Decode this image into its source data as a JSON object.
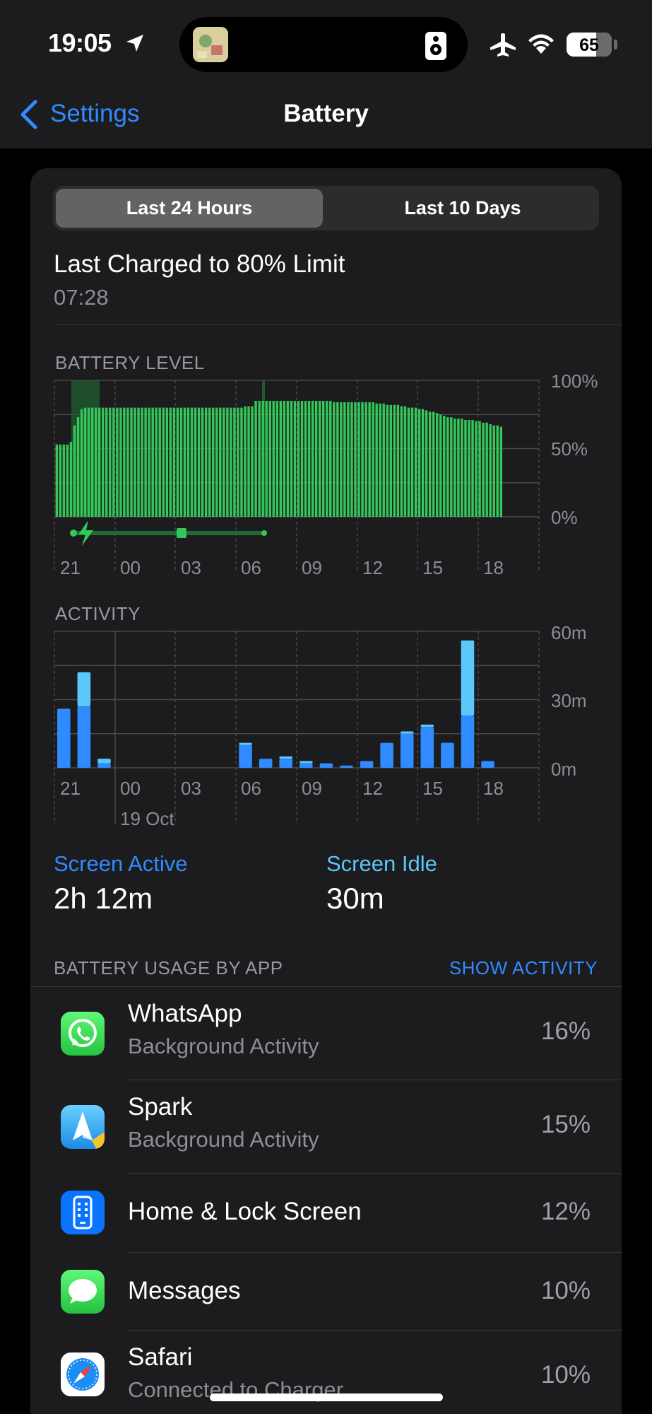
{
  "status_bar": {
    "time": "19:05",
    "battery_percent": "65",
    "battery_level": 0.65,
    "icons": [
      "location-arrow-icon",
      "now-playing-artwork",
      "speaker-icon",
      "airplane-icon",
      "wifi-icon",
      "battery-icon"
    ]
  },
  "nav": {
    "back_label": "Settings",
    "title": "Battery"
  },
  "segmented": {
    "options": [
      "Last 24 Hours",
      "Last 10 Days"
    ],
    "selected": "Last 24 Hours"
  },
  "last_charged": {
    "title": "Last Charged to 80% Limit",
    "time": "07:28"
  },
  "battery_chart": {
    "label": "BATTERY LEVEL",
    "y_ticks": [
      "100%",
      "50%",
      "0%"
    ],
    "x_ticks": [
      "21",
      "00",
      "03",
      "06",
      "09",
      "12",
      "15",
      "18"
    ]
  },
  "activity_chart": {
    "label": "ACTIVITY",
    "y_ticks": [
      "60m",
      "30m",
      "0m"
    ],
    "x_ticks": [
      "21",
      "00",
      "03",
      "06",
      "09",
      "12",
      "15",
      "18"
    ],
    "date_label": "19 Oct"
  },
  "chart_data": [
    {
      "type": "bar",
      "title": "BATTERY LEVEL",
      "ylim": [
        0,
        100
      ],
      "unit": "%",
      "x_tick_labels": [
        "21",
        "00",
        "03",
        "06",
        "09",
        "12",
        "15",
        "18"
      ],
      "grid": true,
      "values": [
        53,
        53,
        53,
        53,
        55,
        67,
        73,
        79,
        80,
        80,
        80,
        80,
        80,
        80,
        80,
        80,
        80,
        80,
        80,
        80,
        80,
        80,
        80,
        80,
        80,
        80,
        80,
        80,
        80,
        80,
        80,
        80,
        80,
        80,
        80,
        80,
        80,
        80,
        80,
        80,
        80,
        80,
        80,
        80,
        80,
        80,
        80,
        80,
        80,
        80,
        80,
        80,
        80,
        81,
        81,
        81,
        85,
        85,
        85,
        85,
        85,
        85,
        85,
        85,
        85,
        85,
        85,
        85,
        85,
        85,
        85,
        85,
        85,
        85,
        85,
        85,
        85,
        85,
        84,
        84,
        84,
        84,
        84,
        84,
        84,
        84,
        84,
        84,
        84,
        84,
        83,
        83,
        83,
        82,
        82,
        82,
        82,
        81,
        81,
        80,
        80,
        80,
        79,
        79,
        78,
        77,
        77,
        76,
        75,
        74,
        73,
        73,
        72,
        72,
        72,
        71,
        71,
        71,
        70,
        70,
        69,
        69,
        68,
        67,
        67,
        66
      ]
    },
    {
      "type": "bar",
      "title": "ACTIVITY",
      "ylim": [
        0,
        60
      ],
      "unit": "m",
      "x_tick_labels": [
        "21",
        "00",
        "03",
        "06",
        "09",
        "12",
        "15",
        "18"
      ],
      "grid": true,
      "series": [
        {
          "name": "Screen Active",
          "values": [
            26,
            27,
            2,
            0,
            0,
            0,
            0,
            0,
            0,
            0,
            0,
            0,
            0,
            0,
            0,
            0,
            0,
            0,
            0,
            0,
            0,
            0,
            0,
            0,
            0,
            0,
            0,
            0,
            0,
            0,
            0,
            0,
            0,
            0,
            0,
            0,
            0,
            0,
            0,
            0,
            0,
            0,
            0,
            0,
            0,
            0,
            0,
            0,
            0,
            0,
            0,
            0,
            0,
            0,
            0,
            0,
            0,
            0,
            0,
            0,
            0,
            0,
            0,
            0,
            0,
            0,
            0,
            0,
            0,
            0,
            0,
            0,
            0,
            0,
            0,
            0,
            0,
            0,
            0,
            0,
            0,
            0,
            0,
            0,
            0,
            0,
            0,
            0,
            0,
            0,
            0,
            0,
            0,
            0,
            0,
            0,
            0,
            0,
            0,
            0,
            0,
            0,
            0,
            0,
            0,
            0,
            0,
            0,
            0,
            0,
            0,
            0,
            0,
            0,
            0,
            0,
            0,
            0,
            0,
            0,
            0,
            0,
            0,
            0,
            0,
            0
          ]
        },
        {
          "name": "Screen Idle",
          "values": [
            0,
            15,
            2
          ]
        }
      ],
      "hourly": [
        {
          "hour": "21",
          "active": 26,
          "idle": 0
        },
        {
          "hour": "22",
          "active": 27,
          "idle": 15
        },
        {
          "hour": "23",
          "active": 2,
          "idle": 2
        },
        {
          "hour": "00",
          "active": 0,
          "idle": 0
        },
        {
          "hour": "01",
          "active": 0,
          "idle": 0
        },
        {
          "hour": "02",
          "active": 0,
          "idle": 0
        },
        {
          "hour": "03",
          "active": 0,
          "idle": 0
        },
        {
          "hour": "04",
          "active": 0,
          "idle": 0
        },
        {
          "hour": "05",
          "active": 0,
          "idle": 0
        },
        {
          "hour": "06",
          "active": 10,
          "idle": 1
        },
        {
          "hour": "07",
          "active": 4,
          "idle": 0
        },
        {
          "hour": "08",
          "active": 4,
          "idle": 1
        },
        {
          "hour": "09",
          "active": 2,
          "idle": 1
        },
        {
          "hour": "10",
          "active": 2,
          "idle": 0
        },
        {
          "hour": "11",
          "active": 1,
          "idle": 0
        },
        {
          "hour": "12",
          "active": 3,
          "idle": 0
        },
        {
          "hour": "13",
          "active": 11,
          "idle": 0
        },
        {
          "hour": "14",
          "active": 15,
          "idle": 1
        },
        {
          "hour": "15",
          "active": 18,
          "idle": 1
        },
        {
          "hour": "16",
          "active": 11,
          "idle": 0
        },
        {
          "hour": "17",
          "active": 23,
          "idle": 33
        },
        {
          "hour": "18",
          "active": 3,
          "idle": 0
        }
      ]
    }
  ],
  "summary": {
    "active_label": "Screen Active",
    "active_value": "2h 12m",
    "idle_label": "Screen Idle",
    "idle_value": "30m"
  },
  "usage": {
    "header": "BATTERY USAGE BY APP",
    "action": "SHOW ACTIVITY",
    "apps": [
      {
        "name": "WhatsApp",
        "sub": "Background Activity",
        "pct": "16%",
        "icon": "whatsapp-icon"
      },
      {
        "name": "Spark",
        "sub": "Background Activity",
        "pct": "15%",
        "icon": "spark-icon"
      },
      {
        "name": "Home & Lock Screen",
        "sub": "",
        "pct": "12%",
        "icon": "home-lock-screen-icon"
      },
      {
        "name": "Messages",
        "sub": "",
        "pct": "10%",
        "icon": "messages-icon"
      },
      {
        "name": "Safari",
        "sub": "Connected to Charger",
        "pct": "10%",
        "icon": "safari-icon"
      }
    ]
  },
  "colors": {
    "accent_blue": "#2f8bff",
    "idle_blue": "#5ac8fa",
    "battery_green": "#34c759",
    "charging_green_dark": "#1f5a2c",
    "card_bg": "#1c1c1e"
  }
}
